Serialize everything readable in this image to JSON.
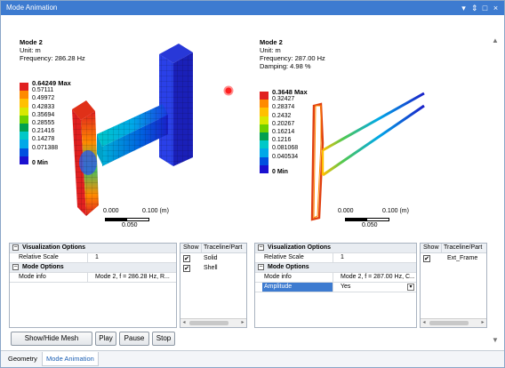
{
  "window": {
    "title": "Mode Animation"
  },
  "title_controls": [
    "▾",
    "⇕",
    "□",
    "×"
  ],
  "left_view": {
    "mode": "Mode 2",
    "unit": "Unit: m",
    "frequency": "Frequency: 286.28 Hz",
    "legend": {
      "max_label": "0.64249 Max",
      "values": [
        "0.57111",
        "0.49972",
        "0.42833",
        "0.35694",
        "0.28555",
        "0.21416",
        "0.14278",
        "0.071388"
      ],
      "min_label": "0 Min"
    },
    "scale": {
      "zero": "0.000",
      "right": "0.100 (m)",
      "mid": "0.050"
    }
  },
  "right_view": {
    "mode": "Mode 2",
    "unit": "Unit: m",
    "frequency": "Frequency: 287.00 Hz",
    "damping": "Damping: 4.98 %",
    "legend": {
      "max_label": "0.3648 Max",
      "values": [
        "0.32427",
        "0.28374",
        "0.2432",
        "0.20267",
        "0.16214",
        "0.1216",
        "0.081068",
        "0.040534"
      ],
      "min_label": "0 Min"
    },
    "scale": {
      "zero": "0.000",
      "right": "0.100 (m)",
      "mid": "0.050"
    }
  },
  "legend_colors": [
    "#e02020",
    "#ff8a00",
    "#ffc000",
    "#d8e800",
    "#6cd000",
    "#00a050",
    "#00c8c8",
    "#00a8e8",
    "#0050e0",
    "#1a10d0"
  ],
  "left_props": {
    "vis_header": "Visualization Options",
    "relative_scale_label": "Relative Scale",
    "relative_scale_value": "1",
    "mode_header": "Mode Options",
    "mode_info_label": "Mode info",
    "mode_info_value": "Mode 2, f = 286.28 Hz, R..."
  },
  "left_show": {
    "header_show": "Show",
    "header_part": "Traceline/Part",
    "items": [
      {
        "label": "Solid",
        "checked": true
      },
      {
        "label": "Shell",
        "checked": true
      }
    ]
  },
  "right_props": {
    "vis_header": "Visualization Options",
    "relative_scale_label": "Relative Scale",
    "relative_scale_value": "1",
    "mode_header": "Mode Options",
    "mode_info_label": "Mode info",
    "mode_info_value": "Mode 2, f = 287.00 Hz, C...",
    "amplitude_label": "Amplitude",
    "amplitude_value": "Yes"
  },
  "right_show": {
    "header_show": "Show",
    "header_part": "Traceline/Part",
    "items": [
      {
        "label": "Ext_Frame",
        "checked": true
      }
    ]
  },
  "buttons": {
    "show_hide_mesh": "Show/Hide Mesh",
    "play": "Play",
    "pause": "Pause",
    "stop": "Stop"
  },
  "tabs": [
    "Geometry",
    "Mode Animation"
  ],
  "check_glyph": "✔",
  "toggle_glyph": "−",
  "dropdown_glyph": "▾"
}
